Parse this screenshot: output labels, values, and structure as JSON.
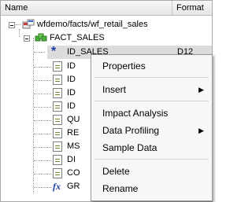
{
  "header": {
    "name_label": "Name",
    "format_label": "Format"
  },
  "tree": {
    "root_label": "wfdemo/facts/wf_retail_sales",
    "segment_label": "FACT_SALES",
    "selected_label": "ID_SALES",
    "selected_format": "D12",
    "rows": [
      {
        "label": "ID"
      },
      {
        "label": "ID"
      },
      {
        "label": "ID"
      },
      {
        "label": "ID"
      },
      {
        "label": "QU"
      },
      {
        "label": "RE"
      },
      {
        "label": "MS"
      },
      {
        "label": "DI"
      },
      {
        "label": "CO"
      },
      {
        "label": "GR"
      }
    ]
  },
  "context_menu": {
    "items": [
      {
        "label": "Properties"
      },
      {
        "label": "Insert",
        "submenu_arrow": "▶"
      },
      {
        "label": "Impact Analysis"
      },
      {
        "label": "Data Profiling",
        "submenu_arrow": "▶"
      },
      {
        "label": "Sample Data"
      },
      {
        "label": "Delete"
      },
      {
        "label": "Rename"
      }
    ]
  },
  "icons": {
    "key_icon": "*",
    "compute_icon": "fx"
  },
  "colors": {
    "menu_bg": "#f7f7f7",
    "selection_bg": "#dcdcdc",
    "key_blue": "#1a3fa8"
  }
}
